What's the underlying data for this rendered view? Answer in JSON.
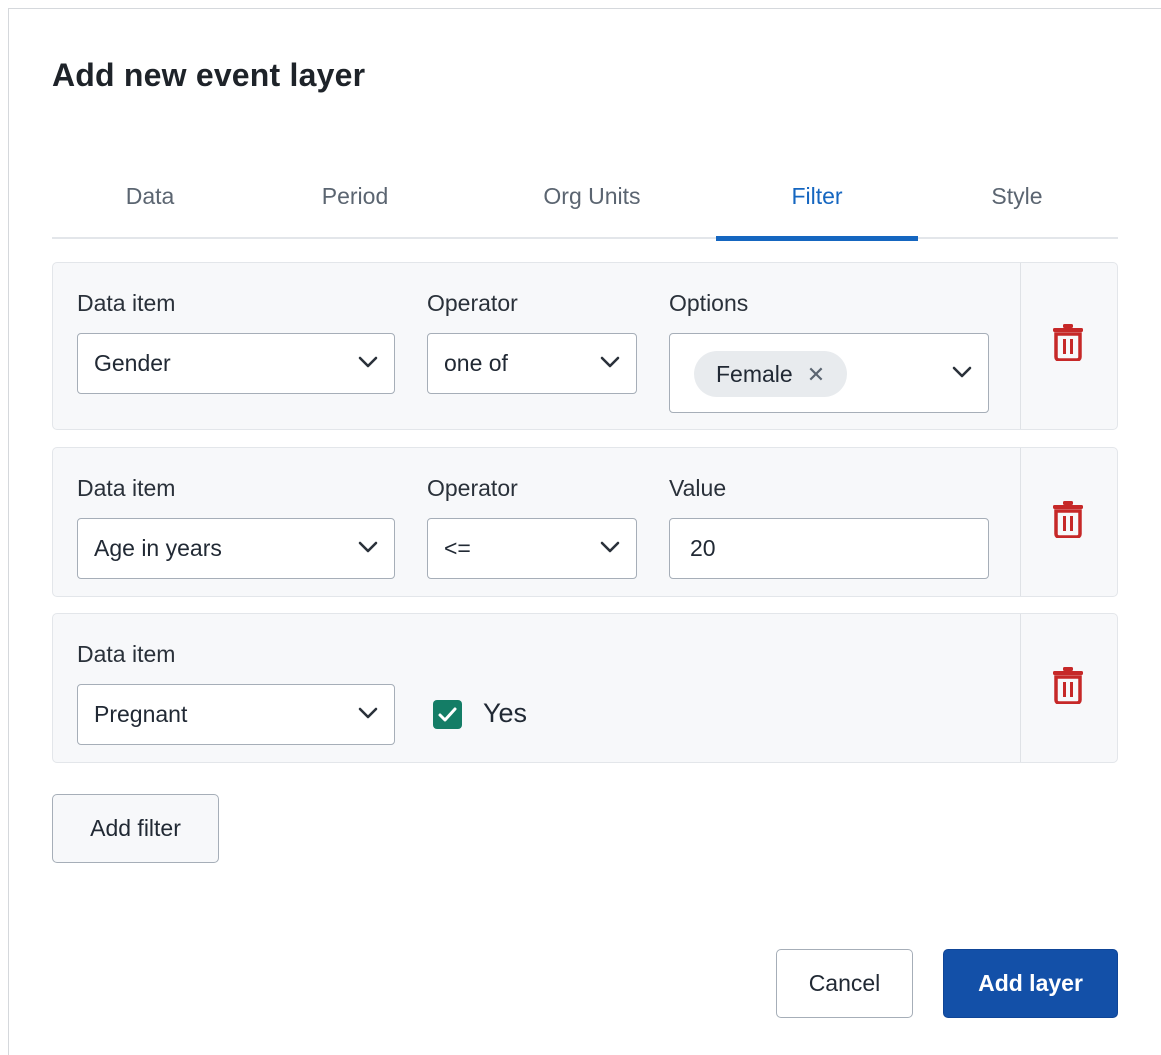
{
  "dialog": {
    "title": "Add new event layer"
  },
  "tabs": [
    {
      "label": "Data",
      "active": false
    },
    {
      "label": "Period",
      "active": false
    },
    {
      "label": "Org Units",
      "active": false
    },
    {
      "label": "Filter",
      "active": true
    },
    {
      "label": "Style",
      "active": false
    }
  ],
  "filters": [
    {
      "data_item_label": "Data item",
      "data_item_value": "Gender",
      "operator_label": "Operator",
      "operator_value": "one of",
      "options_label": "Options",
      "options_selected": [
        "Female"
      ],
      "chip_remove_glyph": "✕"
    },
    {
      "data_item_label": "Data item",
      "data_item_value": "Age in years",
      "operator_label": "Operator",
      "operator_value": "<=",
      "value_label": "Value",
      "value": "20"
    },
    {
      "data_item_label": "Data item",
      "data_item_value": "Pregnant",
      "checkbox_label": "Yes",
      "checkbox_checked": true
    }
  ],
  "buttons": {
    "add_filter": "Add filter",
    "cancel": "Cancel",
    "add_layer": "Add layer"
  },
  "colors": {
    "accent": "#1566c0",
    "primary_button": "#1350a8",
    "delete_icon": "#c62828",
    "checkbox": "#147d66"
  },
  "icons": {
    "delete": "trash-icon",
    "dropdown": "chevron-down-icon",
    "checkbox": "check-icon",
    "chip_remove": "close-icon"
  }
}
